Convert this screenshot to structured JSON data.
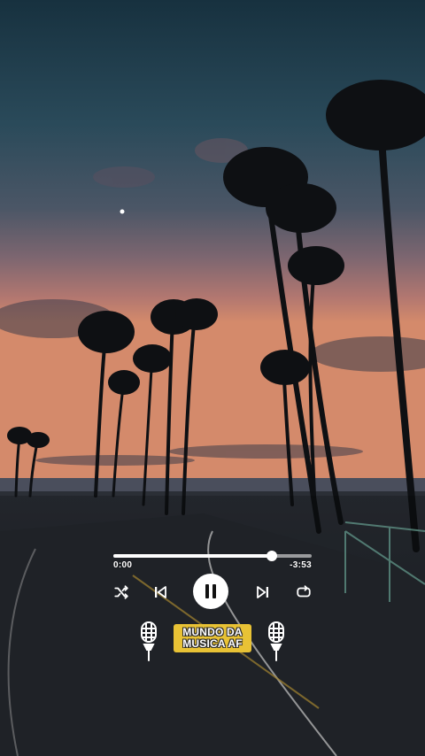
{
  "player": {
    "elapsed": "0:00",
    "remaining": "-3:53",
    "progress": 0.8
  },
  "controls": {
    "shuffle_icon": "shuffle-icon",
    "previous_icon": "skip-previous-icon",
    "play_pause_icon": "pause-icon",
    "next_icon": "skip-next-icon",
    "repeat_icon": "repeat-icon"
  },
  "brand": {
    "line1": "MUNDO DA",
    "line2": "MUSICA AF",
    "color": "#e8c235"
  },
  "icons": {
    "left": "microphone-icon",
    "right": "microphone-icon"
  }
}
